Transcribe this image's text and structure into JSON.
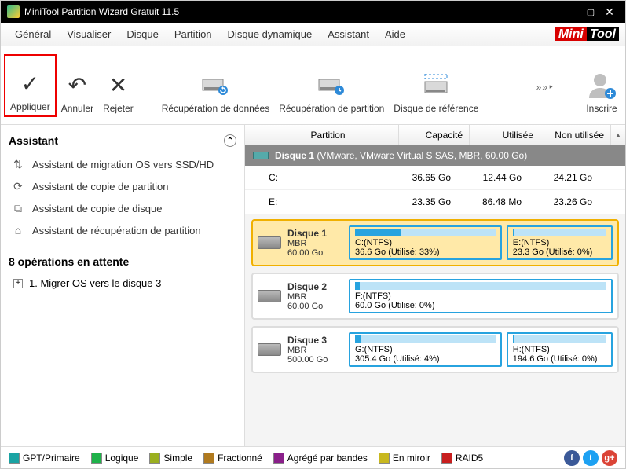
{
  "window": {
    "title": "MiniTool Partition Wizard Gratuit 11.5"
  },
  "menu": [
    "Général",
    "Visualiser",
    "Disque",
    "Partition",
    "Disque dynamique",
    "Assistant",
    "Aide"
  ],
  "logo": {
    "a": "Mini",
    "b": "Tool"
  },
  "toolbar": {
    "apply": "Appliquer",
    "cancel": "Annuler",
    "reject": "Rejeter",
    "datarec": "Récupération de données",
    "partrec": "Récupération de partition",
    "refdisk": "Disque de référence",
    "signup": "Inscrire",
    "more": "»»‣"
  },
  "assistant": {
    "title": "Assistant",
    "items": [
      "Assistant de migration OS vers SSD/HD",
      "Assistant de copie de partition",
      "Assistant de copie de disque",
      "Assistant de récupération de partition"
    ],
    "ops_title": "8 opérations en attente",
    "ops": [
      "1. Migrer OS vers le disque 3"
    ]
  },
  "cols": {
    "part": "Partition",
    "cap": "Capacité",
    "used": "Utilisée",
    "unused": "Non utilisée"
  },
  "disk_header": {
    "name": "Disque 1",
    "desc": "(VMware, VMware Virtual S SAS, MBR, 60.00 Go)"
  },
  "parts": [
    {
      "name": "C:",
      "cap": "36.65 Go",
      "used": "12.44 Go",
      "unused": "24.21 Go"
    },
    {
      "name": "E:",
      "cap": "23.35 Go",
      "used": "86.48 Mo",
      "unused": "23.26 Go"
    }
  ],
  "disks": [
    {
      "name": "Disque 1",
      "type": "MBR",
      "size": "60.00 Go",
      "selected": true,
      "parts": [
        {
          "label": "C:(NTFS)",
          "sub": "36.6 Go (Utilisé: 33%)",
          "flex": 3,
          "fill": 33
        },
        {
          "label": "E:(NTFS)",
          "sub": "23.3 Go (Utilisé: 0%)",
          "flex": 2,
          "fill": 2
        }
      ]
    },
    {
      "name": "Disque 2",
      "type": "MBR",
      "size": "60.00 Go",
      "selected": false,
      "parts": [
        {
          "label": "F:(NTFS)",
          "sub": "60.0 Go (Utilisé: 0%)",
          "flex": 1,
          "fill": 2
        }
      ]
    },
    {
      "name": "Disque 3",
      "type": "MBR",
      "size": "500.00 Go",
      "selected": false,
      "parts": [
        {
          "label": "G:(NTFS)",
          "sub": "305.4 Go (Utilisé: 4%)",
          "flex": 3,
          "fill": 4
        },
        {
          "label": "H:(NTFS)",
          "sub": "194.6 Go (Utilisé: 0%)",
          "flex": 2,
          "fill": 2
        }
      ]
    }
  ],
  "legend": [
    {
      "label": "GPT/Primaire",
      "color": "#1aa3a3"
    },
    {
      "label": "Logique",
      "color": "#1fb24a"
    },
    {
      "label": "Simple",
      "color": "#9aaf1f"
    },
    {
      "label": "Fractionné",
      "color": "#b07a1f"
    },
    {
      "label": "Agrégé par bandes",
      "color": "#8a1f8a"
    },
    {
      "label": "En miroir",
      "color": "#c8b81f"
    },
    {
      "label": "RAID5",
      "color": "#c81f1f"
    }
  ],
  "social": {
    "fb": "f",
    "tw": "t",
    "gp": "g+"
  }
}
